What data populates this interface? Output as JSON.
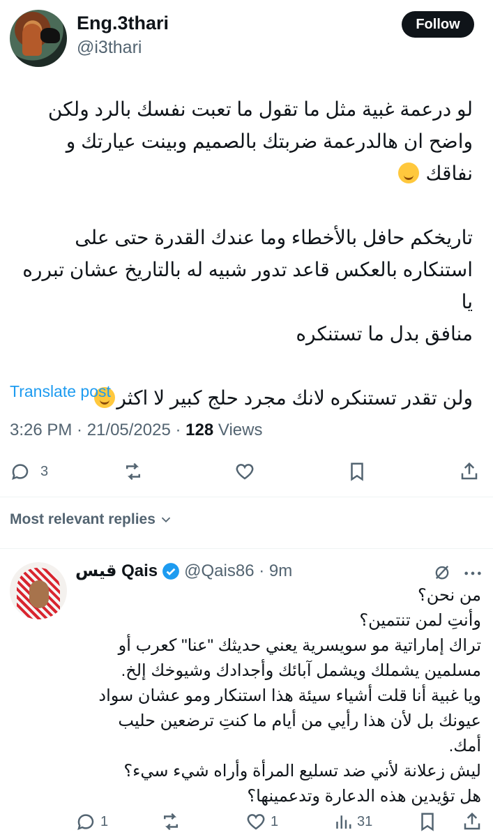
{
  "tweet": {
    "author_name": "Eng.3thari",
    "author_handle": "@i3thari",
    "follow_label": "Follow",
    "text_before_emoji1": "لو درعمة غبية مثل ما تقول ما تعبت نفسك بالرد ولكن\nواضح ان هالدرعمة ضربتك بالصميم وبينت عيارتك و\nنفاقك ",
    "text_middle": "\n\nتاريخكم حافل بالأخطاء وما عندك القدرة حتى على\nاستنكاره بالعكس قاعد تدور شبيه له بالتاريخ عشان تبرره يا\nمنافق بدل ما تستنكره\n\nولن تقدر تستنكره لانك مجرد حلج كبير لا اكثر",
    "emoji_icon": "melting-face-emoji",
    "translate_label": "Translate post",
    "time": "3:26 PM · 21/05/2025 · ",
    "views_count": "128",
    "views_label": " Views",
    "actions": {
      "replies": "3"
    }
  },
  "replies_filter": {
    "label": "Most relevant replies"
  },
  "reply": {
    "name": "قيس Qais",
    "handle_time": "@Qais86 · 9m",
    "verified_color": "#1d9bf0",
    "text": "من نحن؟\nوأنتِ لمن تنتمين؟\nتراك إماراتية مو سويسرية يعني حديثك \"عنا\" كعرب أو\nمسلمين يشملك ويشمل آبائك وأجدادك وشيوخك إلخ.\nويا غبية أنا قلت أشياء سيئة هذا استنكار ومو عشان سواد\nعيونك بل لأن هذا رأيي من أيام ما كنتِ ترضعين حليب\nأمك.\nليش زعلانة لأني ضد تسليع المرأة وأراه شيء سيء؟\nهل تؤيدين هذه الدعارة وتدعمينها؟",
    "actions": {
      "replies": "1",
      "likes": "1",
      "views": "31"
    }
  },
  "colors": {
    "accent": "#1d9bf0",
    "text": "#0f1419",
    "muted": "#536471"
  }
}
